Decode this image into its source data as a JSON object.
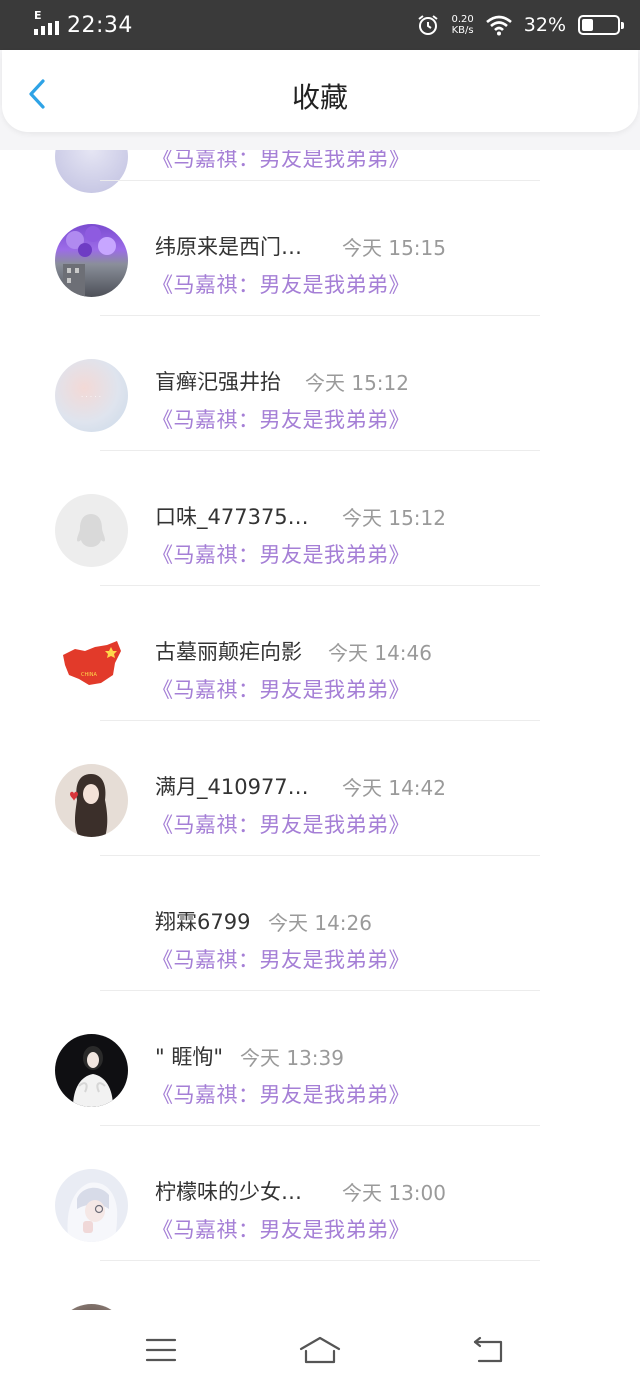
{
  "status_bar": {
    "network": "E",
    "time": "22:34",
    "speed_value": "0.20",
    "speed_unit": "KB/s",
    "battery": "32%"
  },
  "header": {
    "title": "收藏",
    "back_icon": "chevron-left-icon"
  },
  "items": [
    {
      "name": "",
      "time": "",
      "title": "《马嘉祺：男友是我弟弟》",
      "avatar": "partial"
    },
    {
      "name": "纬原来是西门…",
      "time": "今天 15:15",
      "title": "《马嘉祺：男友是我弟弟》",
      "avatar": "purple-balloons"
    },
    {
      "name": "盲癣汜强井抬",
      "time": "今天 15:12",
      "title": "《马嘉祺：男友是我弟弟》",
      "avatar": "pastel-blur"
    },
    {
      "name": "口味_477375…",
      "time": "今天 15:12",
      "title": "《马嘉祺：男友是我弟弟》",
      "avatar": "default-penguin"
    },
    {
      "name": "古墓丽颠疟向影",
      "time": "今天 14:46",
      "title": "《马嘉祺：男友是我弟弟》",
      "avatar": "china-flag"
    },
    {
      "name": "满月_410977…",
      "time": "今天 14:42",
      "title": "《马嘉祺：男友是我弟弟》",
      "avatar": "girl-drawing"
    },
    {
      "name": "翔霖6799",
      "time": "今天 14:26",
      "title": "《马嘉祺：男友是我弟弟》",
      "avatar": "none"
    },
    {
      "name": "\" 睚恂\"",
      "time": "今天 13:39",
      "title": "《马嘉祺：男友是我弟弟》",
      "avatar": "dark-portrait"
    },
    {
      "name": "柠檬味的少女…",
      "time": "今天 13:00",
      "title": "《马嘉祺：男友是我弟弟》",
      "avatar": "anime-girl"
    },
    {
      "name": "",
      "time": "",
      "title": "",
      "avatar": "partial"
    }
  ],
  "nav": {
    "menu_icon": "menu-icon",
    "home_icon": "home-icon",
    "back_icon": "return-icon"
  },
  "colors": {
    "accent_title": "#a57fd6",
    "back_arrow": "#2ea3e6",
    "status_bar": "#3a3a3a"
  }
}
